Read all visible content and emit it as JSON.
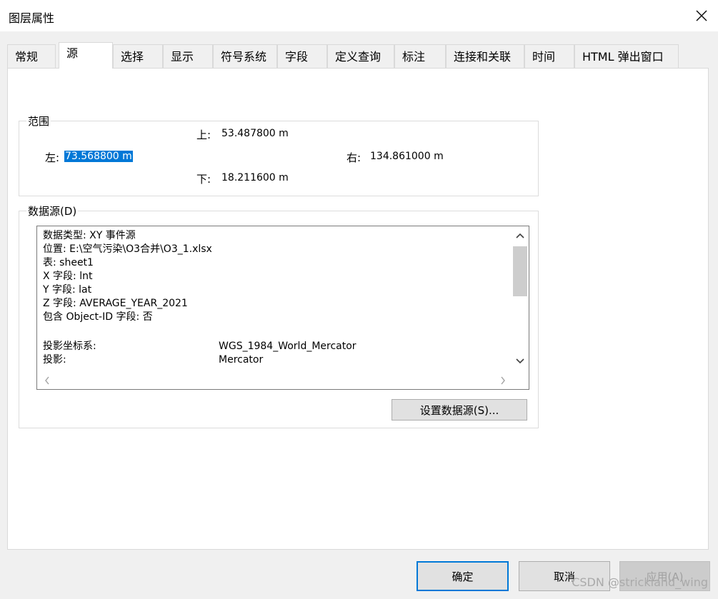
{
  "window": {
    "title": "图层属性"
  },
  "tabs": [
    {
      "label": "常规"
    },
    {
      "label": "源"
    },
    {
      "label": "选择"
    },
    {
      "label": "显示"
    },
    {
      "label": "符号系统"
    },
    {
      "label": "字段"
    },
    {
      "label": "定义查询"
    },
    {
      "label": "标注"
    },
    {
      "label": "连接和关联"
    },
    {
      "label": "时间"
    },
    {
      "label": "HTML 弹出窗口"
    }
  ],
  "active_tab": "源",
  "extent": {
    "legend": "范围",
    "top_label": "上:",
    "top_value": "53.487800 m",
    "left_label": "左:",
    "left_value": "73.568800 m",
    "right_label": "右:",
    "right_value": "134.861000 m",
    "bottom_label": "下:",
    "bottom_value": "18.211600 m"
  },
  "datasource": {
    "legend": "数据源(D)",
    "lines": [
      "数据类型: XY 事件源",
      "位置: E:\\空气污染\\O3合并\\O3_1.xlsx",
      "表: sheet1",
      "X 字段: lnt",
      "Y 字段: lat",
      "Z 字段: AVERAGE_YEAR_2021",
      "包含 Object-ID 字段: 否"
    ],
    "projection_rows": [
      {
        "key": "投影坐标系:",
        "value": "WGS_1984_World_Mercator"
      },
      {
        "key": "投影:",
        "value": "Mercator"
      }
    ],
    "set_button": "设置数据源(S)..."
  },
  "footer": {
    "ok": "确定",
    "cancel": "取消",
    "apply": "应用(A)"
  },
  "watermark": "CSDN @strickland_wing"
}
